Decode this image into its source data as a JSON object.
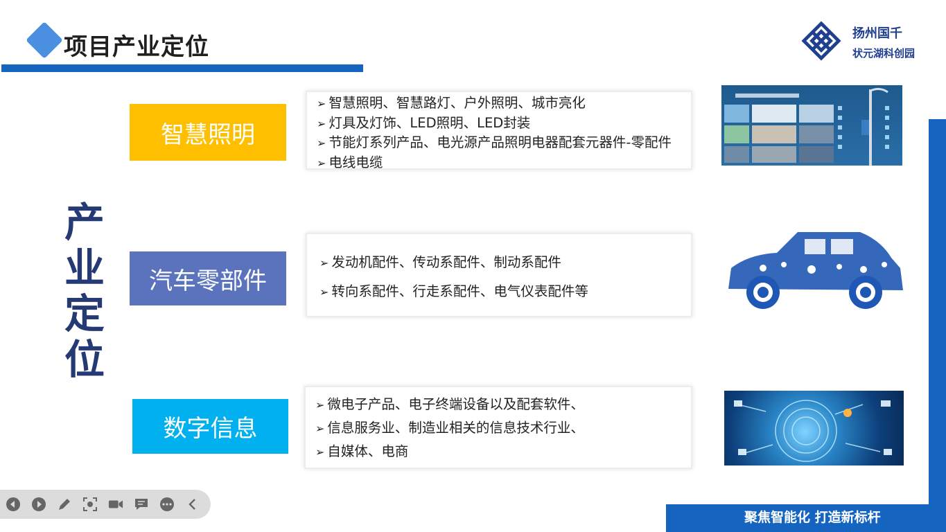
{
  "header": {
    "title": "项目产业定位"
  },
  "logo": {
    "name": "扬州国千",
    "sub": "状元湖科创园"
  },
  "side_heading": [
    "产",
    "业",
    "定",
    "位"
  ],
  "categories": [
    {
      "label": "智慧照明",
      "color": "#fdbf00",
      "items": [
        "智慧照明、智慧路灯、户外照明、城市亮化",
        "灯具及灯饰、LED照明、LED封装",
        "节能灯系列产品、电光源产品照明电器配套元器件-零配件",
        "电线电缆"
      ]
    },
    {
      "label": "汽车零部件",
      "color": "#5b72bd",
      "items": [
        "发动机配件、传动系配件、制动系配件",
        "转向系配件、行走系配件、电气仪表配件等"
      ]
    },
    {
      "label": "数字信息",
      "color": "#00b0ef",
      "items": [
        "微电子产品、电子终端设备以及配套软件、",
        "信息服务业、制造业相关的信息技术行业、",
        "自媒体、电商"
      ]
    }
  ],
  "footer": {
    "slogan": "聚焦智能化 打造新标杆"
  },
  "toolbar": {
    "icons": [
      "previous-icon",
      "next-icon",
      "pen-icon",
      "screenshot-icon",
      "video-icon",
      "comment-icon",
      "more-icon",
      "collapse-icon"
    ]
  },
  "colors": {
    "accent": "#1565c0",
    "heading": "#253a75"
  }
}
